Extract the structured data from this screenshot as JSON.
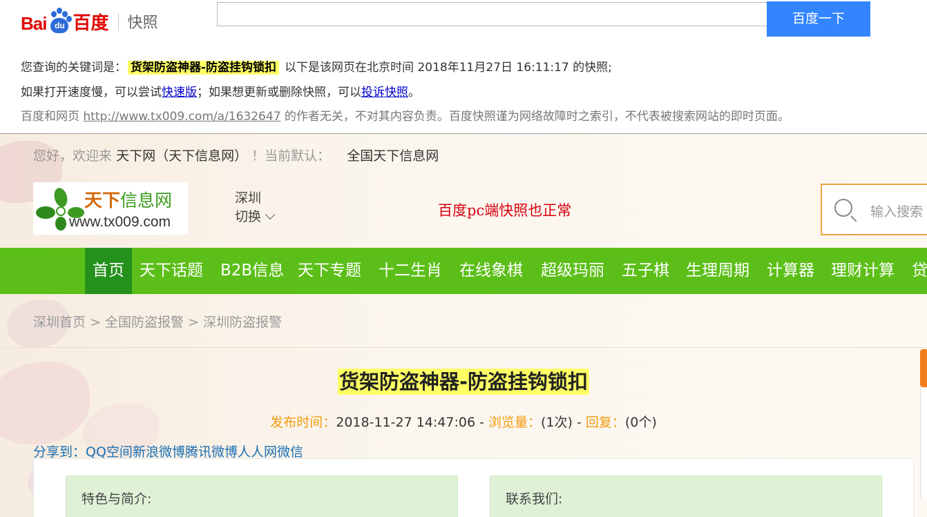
{
  "baidu": {
    "logo_bai": "Bai",
    "logo_du": "du",
    "logo_baidu": "百度",
    "logo_kuaizhao": "快照",
    "search_value": "",
    "search_button": "百度一下",
    "info_line1_prefix": "您查询的关键词是：",
    "keyword": "货架防盗神器-防盗挂钩锁扣",
    "info_line1_suffix": "以下是该网页在北京时间 2018年11月27日 16:11:17 的快照;",
    "info_line2_a": "如果打开速度慢，可以尝试",
    "fast_link": "快速版",
    "info_line2_b": "；如果想更新或删除快照，可以",
    "complaint_link": "投诉快照",
    "info_line2_c": "。",
    "info_line3_a": "百度和网页",
    "source_url": "http://www.tx009.com/a/1632647",
    "info_line3_b": "的作者无关，不对其内容负责。百度快照谨为网络故障时之索引，不代表被搜索网站的即时页面。",
    "accent_color": "#3385ff",
    "brand_red": "#e10602"
  },
  "site": {
    "welcome_a": "您好，欢迎来",
    "welcome_site": "天下网（天下信息网）",
    "welcome_b": "！当前默认：",
    "welcome_default": "全国天下信息网",
    "logo_tianxia": "天下",
    "logo_xinxi": "信息网",
    "logo_url": "www.tx009.com",
    "city_name": "深圳",
    "city_switch": "切换",
    "overlay_note": "百度pc端快照也正常",
    "search_placeholder": "输入搜索",
    "nav": [
      "首页",
      "天下话题",
      "B2B信息",
      "天下专题",
      "十二生肖",
      "在线象棋",
      "超级玛丽",
      "五子棋",
      "生理周期",
      "计算器",
      "理财计算",
      "贷"
    ],
    "nav_color": "#5cbf19",
    "nav_active_color": "#24911c",
    "breadcrumb": [
      "深圳首页",
      ">",
      "全国防盗报警",
      ">",
      "深圳防盗报警"
    ],
    "article_title": "货架防盗神器-防盗挂钩锁扣",
    "meta_publish_label": "发布时间：",
    "meta_publish_value": "2018-11-27 14:47:06",
    "meta_sep1": " - ",
    "meta_views_label": "浏览量：",
    "meta_views_value": "(1次)",
    "meta_sep2": " - ",
    "meta_reply_label": "回复：",
    "meta_reply_value": "(0个)",
    "share_label": "分享到：",
    "share_targets": [
      "QQ空间",
      "新浪微博",
      "腾讯微博",
      "人人网",
      "微信"
    ],
    "panel_left_title": "特色与简介:",
    "panel_right_title": "联系我们:"
  }
}
